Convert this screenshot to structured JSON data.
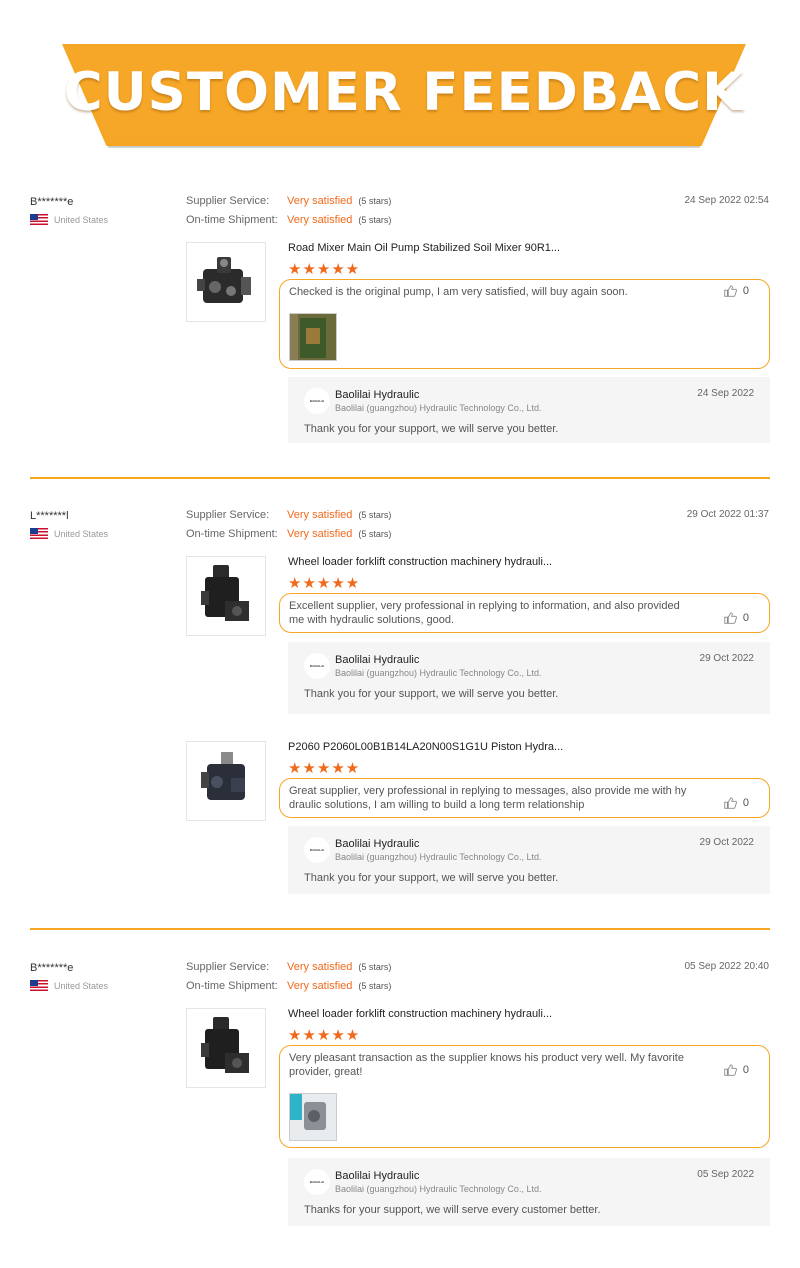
{
  "banner": {
    "title": "CUSTOMER FEEDBACK"
  },
  "colors": {
    "accent": "#f5a623",
    "satisfied": "#f06a1d"
  },
  "labels": {
    "supplier_service": "Supplier Service:",
    "ontime_shipment": "On-time Shipment:",
    "very_satisfied": "Very satisfied",
    "five_stars": "(5 stars)",
    "star_rating": "★★★★★",
    "like_icon": "thumbs-up-icon"
  },
  "reviews": [
    {
      "buyer": "B*******e",
      "country": "United States",
      "date": "24 Sep 2022 02:54",
      "products": [
        {
          "title": "Road Mixer Main Oil Pump Stabilized Soil Mixer 90R1...",
          "comment": "Checked is the original pump, I am very satisfied, will buy again soon.",
          "likes": "0",
          "reply": {
            "logo": "BAOLILAI",
            "name": "Baolilai Hydraulic",
            "company": "Baolilai (guangzhou) Hydraulic Technology Co., Ltd.",
            "date": "24 Sep 2022",
            "text": "Thank you for your support, we will serve you better."
          }
        }
      ]
    },
    {
      "buyer": "L*******l",
      "country": "United States",
      "date": "29 Oct 2022 01:37",
      "products": [
        {
          "title": "Wheel loader forklift construction machinery hydrauli...",
          "comment": "Excellent supplier, very professional in replying to information, and also provided me with hydraulic solutions, good.",
          "likes": "0",
          "reply": {
            "logo": "BAOLILAI",
            "name": "Baolilai Hydraulic",
            "company": "Baolilai (guangzhou) Hydraulic Technology Co., Ltd.",
            "date": "29 Oct 2022",
            "text": "Thank you for your support, we will serve you better."
          }
        },
        {
          "title": "P2060 P2060L00B1B14LA20N00S1G1U Piston Hydra...",
          "comment": "Great supplier, very professional in replying to messages, also provide me with hy draulic solutions, I am willing to build a long term relationship",
          "likes": "0",
          "reply": {
            "logo": "BAOLILAI",
            "name": "Baolilai Hydraulic",
            "company": "Baolilai (guangzhou) Hydraulic Technology Co., Ltd.",
            "date": "29 Oct 2022",
            "text": "Thank you for your support, we will serve you better."
          }
        }
      ]
    },
    {
      "buyer": "B*******e",
      "country": "United States",
      "date": "05 Sep 2022 20:40",
      "products": [
        {
          "title": "Wheel loader forklift construction machinery hydrauli...",
          "comment": "Very pleasant transaction as the supplier knows his product very well. My favorite provider, great!",
          "likes": "0",
          "reply": {
            "logo": "BAOLILAI",
            "name": "Baolilai Hydraulic",
            "company": "Baolilai (guangzhou) Hydraulic Technology Co., Ltd.",
            "date": "05 Sep 2022",
            "text": "Thanks for your support, we will serve every customer better."
          }
        }
      ]
    }
  ]
}
